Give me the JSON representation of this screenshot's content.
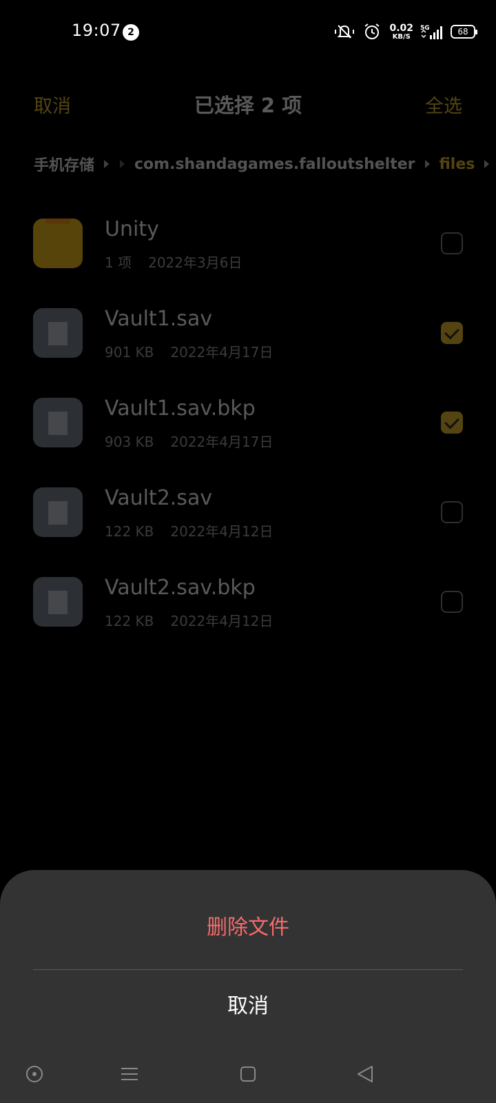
{
  "status_bar": {
    "time": "19:07",
    "notification_count": "2",
    "net_speed": "0.02",
    "net_speed_unit": "KB/S",
    "network_type": "5G",
    "battery": "68",
    "icons": [
      "vibrate-icon",
      "alarm-icon",
      "data-arrows-icon",
      "signal-icon",
      "battery-icon"
    ]
  },
  "header": {
    "cancel_label": "取消",
    "title": "已选择 2 项",
    "select_all_label": "全选"
  },
  "breadcrumb": {
    "items": [
      "手机存储",
      "com.shandagames.falloutshelter",
      "files"
    ]
  },
  "files": [
    {
      "name": "Unity",
      "meta1": "1 项",
      "meta2": "2022年3月6日",
      "type": "folder",
      "checked": false
    },
    {
      "name": "Vault1.sav",
      "meta1": "901 KB",
      "meta2": "2022年4月17日",
      "type": "file",
      "checked": true
    },
    {
      "name": "Vault1.sav.bkp",
      "meta1": "903 KB",
      "meta2": "2022年4月17日",
      "type": "file",
      "checked": true
    },
    {
      "name": "Vault2.sav",
      "meta1": "122 KB",
      "meta2": "2022年4月12日",
      "type": "file",
      "checked": false
    },
    {
      "name": "Vault2.sav.bkp",
      "meta1": "122 KB",
      "meta2": "2022年4月12日",
      "type": "file",
      "checked": false
    }
  ],
  "sheet": {
    "delete_label": "删除文件",
    "cancel_label": "取消"
  },
  "colors": {
    "accent": "#f1c232",
    "danger": "#f56c6c",
    "sheet_bg": "#333333"
  }
}
